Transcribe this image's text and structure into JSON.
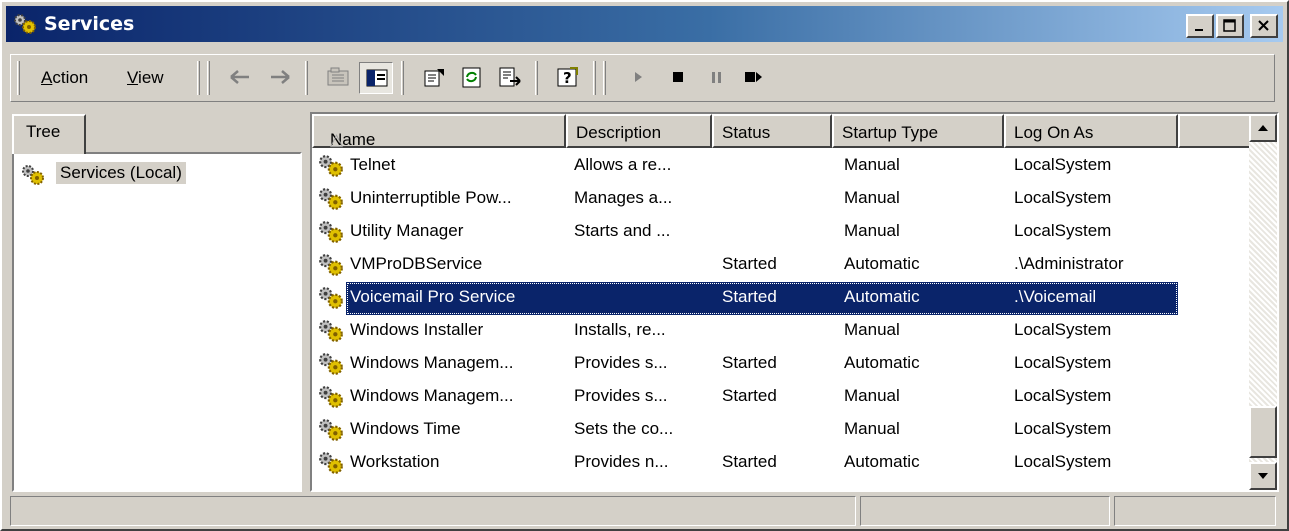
{
  "window": {
    "title": "Services"
  },
  "menu": {
    "action": "Action",
    "action_key": "A",
    "action_rest": "ction",
    "view": "View",
    "view_key": "V",
    "view_rest": "iew"
  },
  "tree": {
    "tab_label": "Tree",
    "root_label": "Services (Local)"
  },
  "list": {
    "columns": [
      "Name",
      "Description",
      "Status",
      "Startup Type",
      "Log On As"
    ],
    "sort_indicator": "△",
    "rows": [
      {
        "name": "Telnet",
        "description": "Allows a re...",
        "status": "",
        "startup": "Manual",
        "logon": "LocalSystem"
      },
      {
        "name": "Uninterruptible Pow...",
        "description": "Manages a...",
        "status": "",
        "startup": "Manual",
        "logon": "LocalSystem"
      },
      {
        "name": "Utility Manager",
        "description": "Starts and ...",
        "status": "",
        "startup": "Manual",
        "logon": "LocalSystem"
      },
      {
        "name": "VMProDBService",
        "description": "",
        "status": "Started",
        "startup": "Automatic",
        "logon": ".\\Administrator"
      },
      {
        "name": "Voicemail Pro Service",
        "description": "",
        "status": "Started",
        "startup": "Automatic",
        "logon": ".\\Voicemail",
        "selected": true
      },
      {
        "name": "Windows Installer",
        "description": "Installs, re...",
        "status": "",
        "startup": "Manual",
        "logon": "LocalSystem"
      },
      {
        "name": "Windows Managem...",
        "description": "Provides s...",
        "status": "Started",
        "startup": "Automatic",
        "logon": "LocalSystem"
      },
      {
        "name": "Windows Managem...",
        "description": "Provides s...",
        "status": "Started",
        "startup": "Manual",
        "logon": "LocalSystem"
      },
      {
        "name": "Windows Time",
        "description": "Sets the co...",
        "status": "",
        "startup": "Manual",
        "logon": "LocalSystem"
      },
      {
        "name": "Workstation",
        "description": "Provides n...",
        "status": "Started",
        "startup": "Automatic",
        "logon": "LocalSystem"
      }
    ]
  },
  "colors": {
    "titlebar_start": "#0a246a",
    "titlebar_end": "#a6caf0",
    "selection": "#0a246a",
    "face": "#d4d0c8"
  },
  "icons": [
    "services-gear-icon",
    "minimize-icon",
    "maximize-icon",
    "close-icon",
    "back-arrow-icon",
    "forward-arrow-icon",
    "up-folder-icon",
    "show-hide-tree-icon",
    "properties-icon",
    "refresh-icon",
    "export-list-icon",
    "help-icon",
    "start-service-icon",
    "stop-service-icon",
    "pause-service-icon",
    "restart-service-icon"
  ]
}
